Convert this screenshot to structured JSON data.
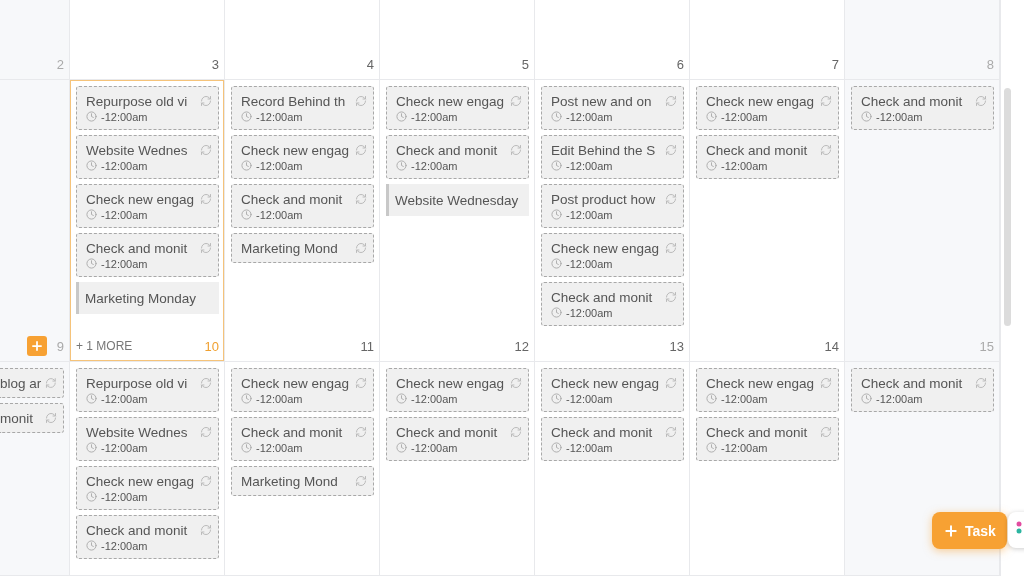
{
  "weeks": [
    {
      "days": [
        {
          "number": "2",
          "weekend": true,
          "today": false,
          "add_button": false
        },
        {
          "number": "3",
          "weekend": false,
          "today": false,
          "add_button": false
        },
        {
          "number": "4",
          "weekend": false,
          "today": false,
          "add_button": false
        },
        {
          "number": "5",
          "weekend": false,
          "today": false,
          "add_button": false
        },
        {
          "number": "6",
          "weekend": false,
          "today": false,
          "add_button": false
        },
        {
          "number": "7",
          "weekend": false,
          "today": false,
          "add_button": false
        },
        {
          "number": "8",
          "weekend": true,
          "today": false,
          "add_button": false
        }
      ]
    },
    {
      "days": [
        {
          "number": "9",
          "weekend": true,
          "today": false,
          "add_button": true
        },
        {
          "number": "10",
          "weekend": false,
          "today": true,
          "add_button": false,
          "more": "+ 1 MORE",
          "tasks": [
            {
              "kind": "recurring",
              "title": "Repurpose old vi",
              "time": "-12:00am"
            },
            {
              "kind": "recurring",
              "title": "Website Wednes",
              "time": "-12:00am"
            },
            {
              "kind": "recurring",
              "title": "Check new engag",
              "time": "-12:00am"
            },
            {
              "kind": "recurring",
              "title": "Check and monit",
              "time": "-12:00am"
            },
            {
              "kind": "bar",
              "title": "Marketing Monday"
            }
          ]
        },
        {
          "number": "11",
          "weekend": false,
          "today": false,
          "add_button": false,
          "tasks": [
            {
              "kind": "recurring",
              "title": "Record Behind th",
              "time": "-12:00am"
            },
            {
              "kind": "recurring",
              "title": "Check new engag",
              "time": "-12:00am"
            },
            {
              "kind": "recurring",
              "title": "Check and monit",
              "time": "-12:00am"
            },
            {
              "kind": "recurring",
              "title": "Marketing Mond"
            }
          ]
        },
        {
          "number": "12",
          "weekend": false,
          "today": false,
          "add_button": false,
          "tasks": [
            {
              "kind": "recurring",
              "title": "Check new engag",
              "time": "-12:00am"
            },
            {
              "kind": "recurring",
              "title": "Check and monit",
              "time": "-12:00am"
            },
            {
              "kind": "bar",
              "title": "Website Wednesday"
            }
          ]
        },
        {
          "number": "13",
          "weekend": false,
          "today": false,
          "add_button": false,
          "tasks": [
            {
              "kind": "recurring",
              "title": "Post new and on",
              "time": "-12:00am"
            },
            {
              "kind": "recurring",
              "title": "Edit Behind the S",
              "time": "-12:00am"
            },
            {
              "kind": "recurring",
              "title": "Post product how",
              "time": "-12:00am"
            },
            {
              "kind": "recurring",
              "title": "Check new engag",
              "time": "-12:00am"
            },
            {
              "kind": "recurring",
              "title": "Check and monit",
              "time": "-12:00am"
            }
          ]
        },
        {
          "number": "14",
          "weekend": false,
          "today": false,
          "add_button": false,
          "tasks": [
            {
              "kind": "recurring",
              "title": "Check new engag",
              "time": "-12:00am"
            },
            {
              "kind": "recurring",
              "title": "Check and monit",
              "time": "-12:00am"
            }
          ]
        },
        {
          "number": "15",
          "weekend": true,
          "today": false,
          "add_button": false,
          "tasks": [
            {
              "kind": "recurring",
              "title": "Check and monit",
              "time": "-12:00am"
            }
          ]
        }
      ]
    },
    {
      "days": [
        {
          "weekend": true,
          "today": false,
          "add_button": false,
          "tasks": [
            {
              "kind": "recurring",
              "title": "blog ar"
            },
            {
              "kind": "recurring",
              "title": "monit"
            }
          ]
        },
        {
          "weekend": false,
          "today": false,
          "add_button": false,
          "tasks": [
            {
              "kind": "recurring",
              "title": "Repurpose old vi",
              "time": "-12:00am"
            },
            {
              "kind": "recurring",
              "title": "Website Wednes",
              "time": "-12:00am"
            },
            {
              "kind": "recurring",
              "title": "Check new engag",
              "time": "-12:00am"
            },
            {
              "kind": "recurring",
              "title": "Check and monit",
              "time": "-12:00am"
            }
          ]
        },
        {
          "weekend": false,
          "today": false,
          "add_button": false,
          "tasks": [
            {
              "kind": "recurring",
              "title": "Check new engag",
              "time": "-12:00am"
            },
            {
              "kind": "recurring",
              "title": "Check and monit",
              "time": "-12:00am"
            },
            {
              "kind": "recurring",
              "title": "Marketing Mond"
            }
          ]
        },
        {
          "weekend": false,
          "today": false,
          "add_button": false,
          "tasks": [
            {
              "kind": "recurring",
              "title": "Check new engag",
              "time": "-12:00am"
            },
            {
              "kind": "recurring",
              "title": "Check and monit",
              "time": "-12:00am"
            }
          ]
        },
        {
          "weekend": false,
          "today": false,
          "add_button": false,
          "tasks": [
            {
              "kind": "recurring",
              "title": "Check new engag",
              "time": "-12:00am"
            },
            {
              "kind": "recurring",
              "title": "Check and monit",
              "time": "-12:00am"
            }
          ]
        },
        {
          "weekend": false,
          "today": false,
          "add_button": false,
          "tasks": [
            {
              "kind": "recurring",
              "title": "Check new engag",
              "time": "-12:00am"
            },
            {
              "kind": "recurring",
              "title": "Check and monit",
              "time": "-12:00am"
            }
          ]
        },
        {
          "weekend": true,
          "today": false,
          "add_button": false,
          "tasks": [
            {
              "kind": "recurring",
              "title": "Check and monit",
              "time": "-12:00am"
            }
          ]
        }
      ]
    }
  ],
  "fab": {
    "label": "Task"
  }
}
